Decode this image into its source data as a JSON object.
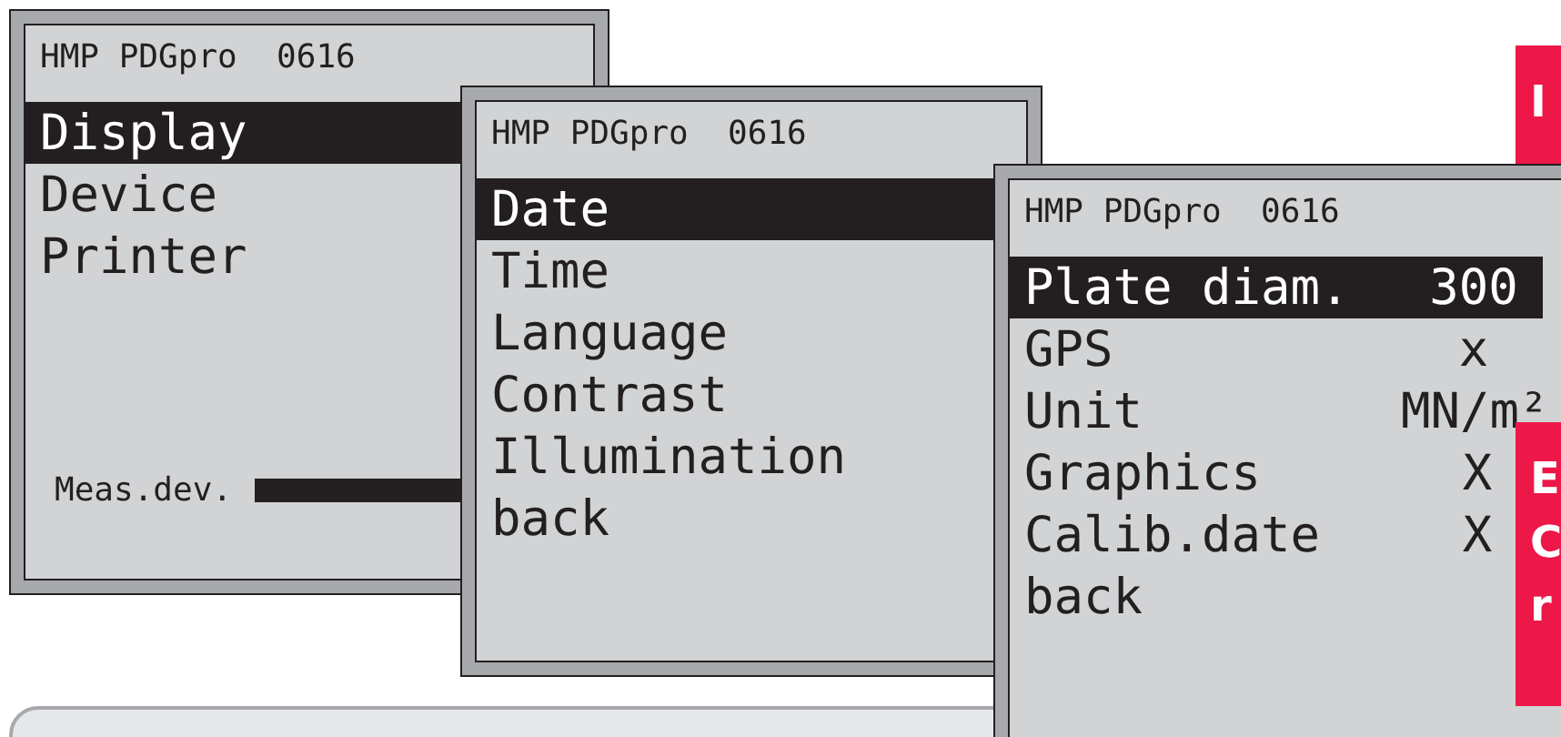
{
  "screens": [
    {
      "header": "HMP PDGpro  0616",
      "items": [
        {
          "label": "Display",
          "selected": true
        },
        {
          "label": "Device",
          "selected": false
        },
        {
          "label": "Printer",
          "selected": false
        }
      ],
      "footer": {
        "label": "Meas.dev."
      }
    },
    {
      "header": "HMP PDGpro  0616",
      "items": [
        {
          "label": "Date",
          "selected": true
        },
        {
          "label": "Time",
          "selected": false
        },
        {
          "label": "Language",
          "selected": false
        },
        {
          "label": "Contrast",
          "selected": false
        },
        {
          "label": "Illumination",
          "selected": false
        },
        {
          "label": "back",
          "selected": false
        }
      ]
    },
    {
      "header": "HMP PDGpro  0616",
      "items": [
        {
          "label": "Plate diam.",
          "value": "300",
          "selected": true
        },
        {
          "label": "GPS",
          "value": "x",
          "selected": false
        },
        {
          "label": "Unit",
          "value": "MN/m²",
          "selected": false
        },
        {
          "label": "Graphics",
          "value": "X",
          "selected": false
        },
        {
          "label": "Calib.date",
          "value": "X",
          "selected": false
        },
        {
          "label": "back",
          "selected": false
        }
      ]
    }
  ],
  "notes": [
    {
      "lines": [
        "I"
      ]
    },
    {
      "lines": [
        "E",
        "C",
        "r"
      ]
    }
  ]
}
